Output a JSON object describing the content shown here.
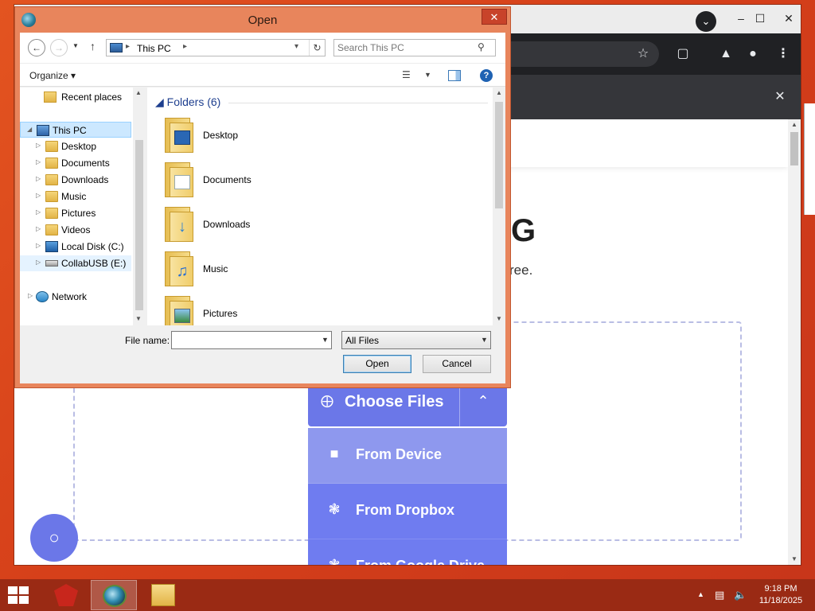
{
  "browser": {
    "tab_search_icon": "chevron-down-icon",
    "toolbar_icons": [
      "star-icon",
      "extensions-icon",
      "labs-icon",
      "profile-icon",
      "menu-icon"
    ]
  },
  "page": {
    "heading_partial": "G",
    "subtext_partial": "ree.",
    "choose_files_label": "Choose Files",
    "dropdown_items": [
      {
        "label": "From Device",
        "icon": "folder-icon"
      },
      {
        "label": "From Dropbox",
        "icon": "dropbox-icon"
      },
      {
        "label": "From Google Drive",
        "icon": "google-drive-icon"
      }
    ]
  },
  "dialog": {
    "title": "Open",
    "address": "This PC",
    "search_placeholder": "Search This PC",
    "organize_label": "Organize",
    "nav_tree": [
      {
        "label": "Recent places",
        "icon": "recent-places-icon"
      },
      {
        "label": "This PC",
        "icon": "pc-icon",
        "selected": true
      },
      {
        "label": "Desktop",
        "icon": "folder-icon"
      },
      {
        "label": "Documents",
        "icon": "folder-icon"
      },
      {
        "label": "Downloads",
        "icon": "folder-icon"
      },
      {
        "label": "Music",
        "icon": "folder-icon"
      },
      {
        "label": "Pictures",
        "icon": "folder-icon"
      },
      {
        "label": "Videos",
        "icon": "folder-icon"
      },
      {
        "label": "Local Disk (C:)",
        "icon": "disk-icon"
      },
      {
        "label": "CollabUSB (E:)",
        "icon": "usb-drive-icon"
      },
      {
        "label": "Network",
        "icon": "network-icon"
      }
    ],
    "group_header": "Folders (6)",
    "folders": [
      {
        "label": "Desktop"
      },
      {
        "label": "Documents"
      },
      {
        "label": "Downloads"
      },
      {
        "label": "Music"
      },
      {
        "label": "Pictures"
      }
    ],
    "file_name_label": "File name:",
    "file_name_value": "",
    "filter_value": "All Files",
    "open_label": "Open",
    "cancel_label": "Cancel"
  },
  "taskbar": {
    "time": "9:18 PM",
    "date": "11/18/2025"
  },
  "colors": {
    "accent": "#6b77e8",
    "dialog_frame": "#e8855c",
    "desktop": "#d6401a"
  }
}
